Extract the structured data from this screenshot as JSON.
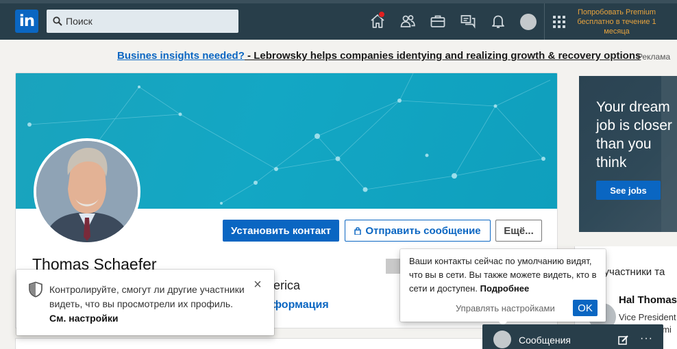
{
  "topbar": {
    "logo_text": "in",
    "search_placeholder": "Поиск",
    "premium_text": "Попробовать Premium бесплатно в течение 1 месяца"
  },
  "ad_line": {
    "link_text": "Busines insights needed?",
    "rest_text": " - Lebrowsky helps companies identying and realizing growth & recovery options",
    "label": "Реклама"
  },
  "profile": {
    "connect_label": "Установить контакт",
    "message_label": "Отправить сообщение",
    "more_label": "Ещё...",
    "name": "Thomas Schaefer",
    "location_fragment": "erica",
    "contact_info_fragment": "формация"
  },
  "jobs_ad": {
    "text": "Your dream job is closer than you think",
    "button": "See jobs"
  },
  "sidebar": {
    "heading_fragment": "е участники та",
    "person_name": "Hal Thomas",
    "person_title": "Vice President",
    "person_title_fragment": "emi"
  },
  "privacy_popup": {
    "text": "Контролируйте, смогут ли другие участники видеть, что вы просмотрели их профиль.",
    "link": "См. настройки"
  },
  "status_popup": {
    "text": "Ваши контакты сейчас по умолчанию видят, что вы в сети. Вы также можете видеть, кто в сети и доступен.",
    "link": "Подробнее",
    "manage": "Управлять настройками",
    "ok": "OK"
  },
  "messaging": {
    "label": "Сообщения",
    "dots": "···"
  }
}
